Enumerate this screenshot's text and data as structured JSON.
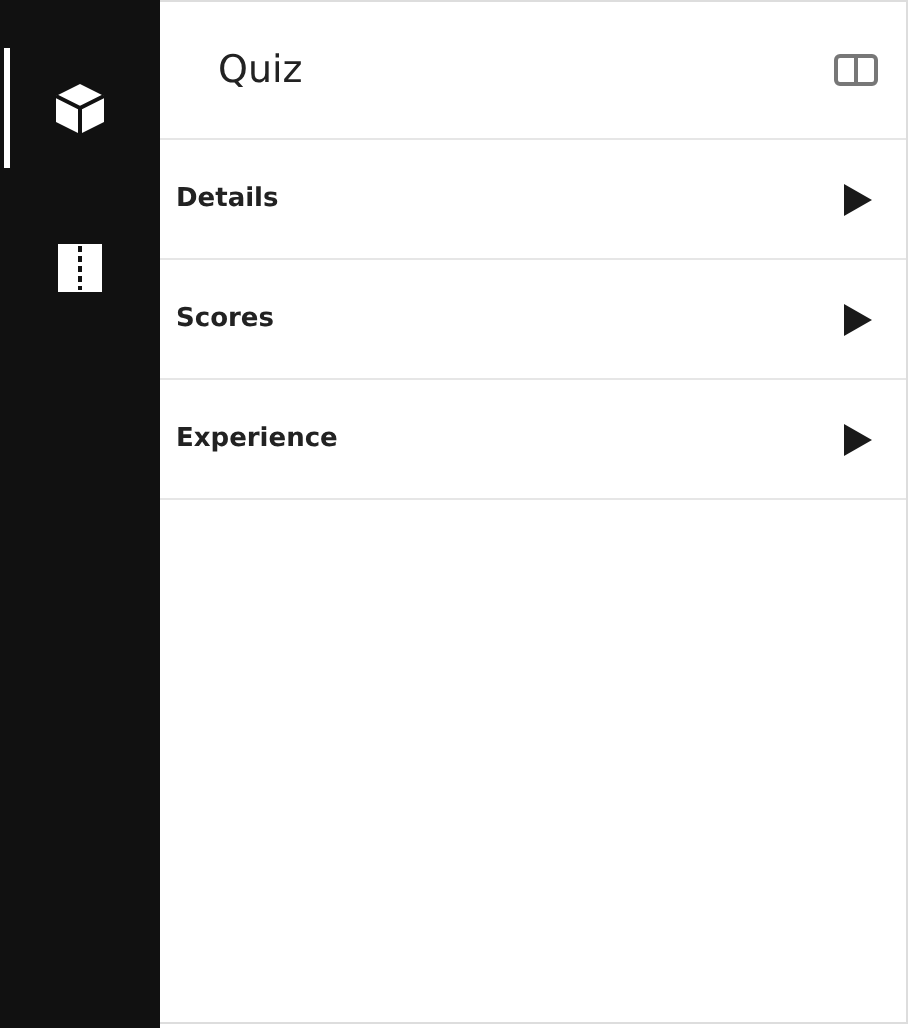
{
  "sidebar": {
    "items": [
      {
        "kind": "cube",
        "selected": true
      },
      {
        "kind": "split",
        "selected": false
      }
    ]
  },
  "panel": {
    "title": "Quiz",
    "sections": [
      {
        "label": "Details",
        "expanded": false
      },
      {
        "label": "Scores",
        "expanded": false
      },
      {
        "label": "Experience",
        "expanded": false
      }
    ]
  }
}
